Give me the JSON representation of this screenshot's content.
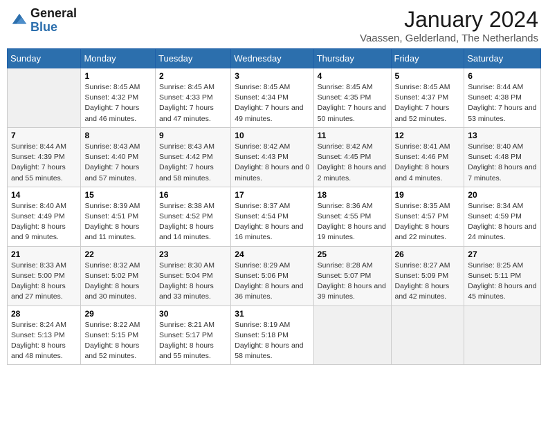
{
  "header": {
    "logo_line1": "General",
    "logo_line2": "Blue",
    "month": "January 2024",
    "location": "Vaassen, Gelderland, The Netherlands"
  },
  "weekdays": [
    "Sunday",
    "Monday",
    "Tuesday",
    "Wednesday",
    "Thursday",
    "Friday",
    "Saturday"
  ],
  "weeks": [
    [
      {
        "day": "",
        "sunrise": "",
        "sunset": "",
        "daylight": ""
      },
      {
        "day": "1",
        "sunrise": "8:45 AM",
        "sunset": "4:32 PM",
        "daylight": "7 hours and 46 minutes."
      },
      {
        "day": "2",
        "sunrise": "8:45 AM",
        "sunset": "4:33 PM",
        "daylight": "7 hours and 47 minutes."
      },
      {
        "day": "3",
        "sunrise": "8:45 AM",
        "sunset": "4:34 PM",
        "daylight": "7 hours and 49 minutes."
      },
      {
        "day": "4",
        "sunrise": "8:45 AM",
        "sunset": "4:35 PM",
        "daylight": "7 hours and 50 minutes."
      },
      {
        "day": "5",
        "sunrise": "8:45 AM",
        "sunset": "4:37 PM",
        "daylight": "7 hours and 52 minutes."
      },
      {
        "day": "6",
        "sunrise": "8:44 AM",
        "sunset": "4:38 PM",
        "daylight": "7 hours and 53 minutes."
      }
    ],
    [
      {
        "day": "7",
        "sunrise": "8:44 AM",
        "sunset": "4:39 PM",
        "daylight": "7 hours and 55 minutes."
      },
      {
        "day": "8",
        "sunrise": "8:43 AM",
        "sunset": "4:40 PM",
        "daylight": "7 hours and 57 minutes."
      },
      {
        "day": "9",
        "sunrise": "8:43 AM",
        "sunset": "4:42 PM",
        "daylight": "7 hours and 58 minutes."
      },
      {
        "day": "10",
        "sunrise": "8:42 AM",
        "sunset": "4:43 PM",
        "daylight": "8 hours and 0 minutes."
      },
      {
        "day": "11",
        "sunrise": "8:42 AM",
        "sunset": "4:45 PM",
        "daylight": "8 hours and 2 minutes."
      },
      {
        "day": "12",
        "sunrise": "8:41 AM",
        "sunset": "4:46 PM",
        "daylight": "8 hours and 4 minutes."
      },
      {
        "day": "13",
        "sunrise": "8:40 AM",
        "sunset": "4:48 PM",
        "daylight": "8 hours and 7 minutes."
      }
    ],
    [
      {
        "day": "14",
        "sunrise": "8:40 AM",
        "sunset": "4:49 PM",
        "daylight": "8 hours and 9 minutes."
      },
      {
        "day": "15",
        "sunrise": "8:39 AM",
        "sunset": "4:51 PM",
        "daylight": "8 hours and 11 minutes."
      },
      {
        "day": "16",
        "sunrise": "8:38 AM",
        "sunset": "4:52 PM",
        "daylight": "8 hours and 14 minutes."
      },
      {
        "day": "17",
        "sunrise": "8:37 AM",
        "sunset": "4:54 PM",
        "daylight": "8 hours and 16 minutes."
      },
      {
        "day": "18",
        "sunrise": "8:36 AM",
        "sunset": "4:55 PM",
        "daylight": "8 hours and 19 minutes."
      },
      {
        "day": "19",
        "sunrise": "8:35 AM",
        "sunset": "4:57 PM",
        "daylight": "8 hours and 22 minutes."
      },
      {
        "day": "20",
        "sunrise": "8:34 AM",
        "sunset": "4:59 PM",
        "daylight": "8 hours and 24 minutes."
      }
    ],
    [
      {
        "day": "21",
        "sunrise": "8:33 AM",
        "sunset": "5:00 PM",
        "daylight": "8 hours and 27 minutes."
      },
      {
        "day": "22",
        "sunrise": "8:32 AM",
        "sunset": "5:02 PM",
        "daylight": "8 hours and 30 minutes."
      },
      {
        "day": "23",
        "sunrise": "8:30 AM",
        "sunset": "5:04 PM",
        "daylight": "8 hours and 33 minutes."
      },
      {
        "day": "24",
        "sunrise": "8:29 AM",
        "sunset": "5:06 PM",
        "daylight": "8 hours and 36 minutes."
      },
      {
        "day": "25",
        "sunrise": "8:28 AM",
        "sunset": "5:07 PM",
        "daylight": "8 hours and 39 minutes."
      },
      {
        "day": "26",
        "sunrise": "8:27 AM",
        "sunset": "5:09 PM",
        "daylight": "8 hours and 42 minutes."
      },
      {
        "day": "27",
        "sunrise": "8:25 AM",
        "sunset": "5:11 PM",
        "daylight": "8 hours and 45 minutes."
      }
    ],
    [
      {
        "day": "28",
        "sunrise": "8:24 AM",
        "sunset": "5:13 PM",
        "daylight": "8 hours and 48 minutes."
      },
      {
        "day": "29",
        "sunrise": "8:22 AM",
        "sunset": "5:15 PM",
        "daylight": "8 hours and 52 minutes."
      },
      {
        "day": "30",
        "sunrise": "8:21 AM",
        "sunset": "5:17 PM",
        "daylight": "8 hours and 55 minutes."
      },
      {
        "day": "31",
        "sunrise": "8:19 AM",
        "sunset": "5:18 PM",
        "daylight": "8 hours and 58 minutes."
      },
      {
        "day": "",
        "sunrise": "",
        "sunset": "",
        "daylight": ""
      },
      {
        "day": "",
        "sunrise": "",
        "sunset": "",
        "daylight": ""
      },
      {
        "day": "",
        "sunrise": "",
        "sunset": "",
        "daylight": ""
      }
    ]
  ],
  "labels": {
    "sunrise": "Sunrise:",
    "sunset": "Sunset:",
    "daylight": "Daylight:"
  }
}
